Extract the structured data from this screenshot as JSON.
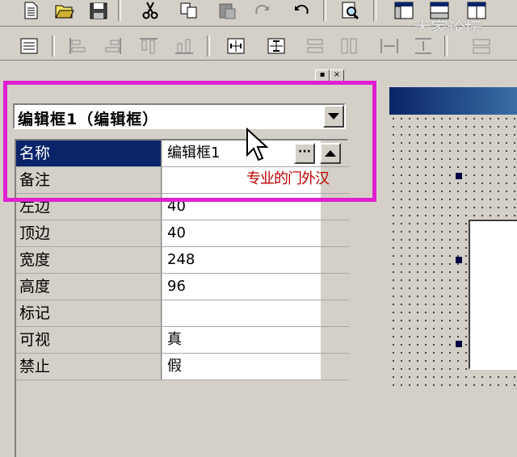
{
  "toolbar_top": {
    "buttons": [
      "new-icon",
      "open-icon",
      "save-icon",
      "cut-icon",
      "copy-icon",
      "paste-icon",
      "redo-icon",
      "undo-icon",
      "find-icon",
      "window-layout-icon",
      "window-split-icon",
      "window-tile-icon"
    ]
  },
  "toolbar_align": {
    "buttons": [
      "form-icon",
      "align-left-icon",
      "align-right-icon",
      "align-top-icon",
      "align-bottom-icon",
      "center-horizontal-icon",
      "center-vertical-icon",
      "equal-width-icon",
      "equal-height-icon",
      "space-horizontal-icon",
      "space-vertical-icon",
      "same-size-icon"
    ]
  },
  "watermark": "大家论坛",
  "panel": {
    "caption_buttons": [
      "▪",
      "×"
    ],
    "object_selector": "编辑框1（编辑框）",
    "rows": [
      {
        "name": "名称",
        "value": "编辑框1",
        "selected": true
      },
      {
        "name": "备注",
        "value": ""
      },
      {
        "name": "左边",
        "value": "40"
      },
      {
        "name": "顶边",
        "value": "40"
      },
      {
        "name": "宽度",
        "value": "248"
      },
      {
        "name": "高度",
        "value": "96"
      },
      {
        "name": "标记",
        "value": ""
      },
      {
        "name": "可视",
        "value": "真"
      },
      {
        "name": "禁止",
        "value": "假"
      }
    ],
    "ellipsis_label": "···"
  },
  "annotation": "专业的门外汉",
  "colors": {
    "highlight": "#e020d0",
    "selection": "#0a246a",
    "annotation": "#c00000"
  }
}
